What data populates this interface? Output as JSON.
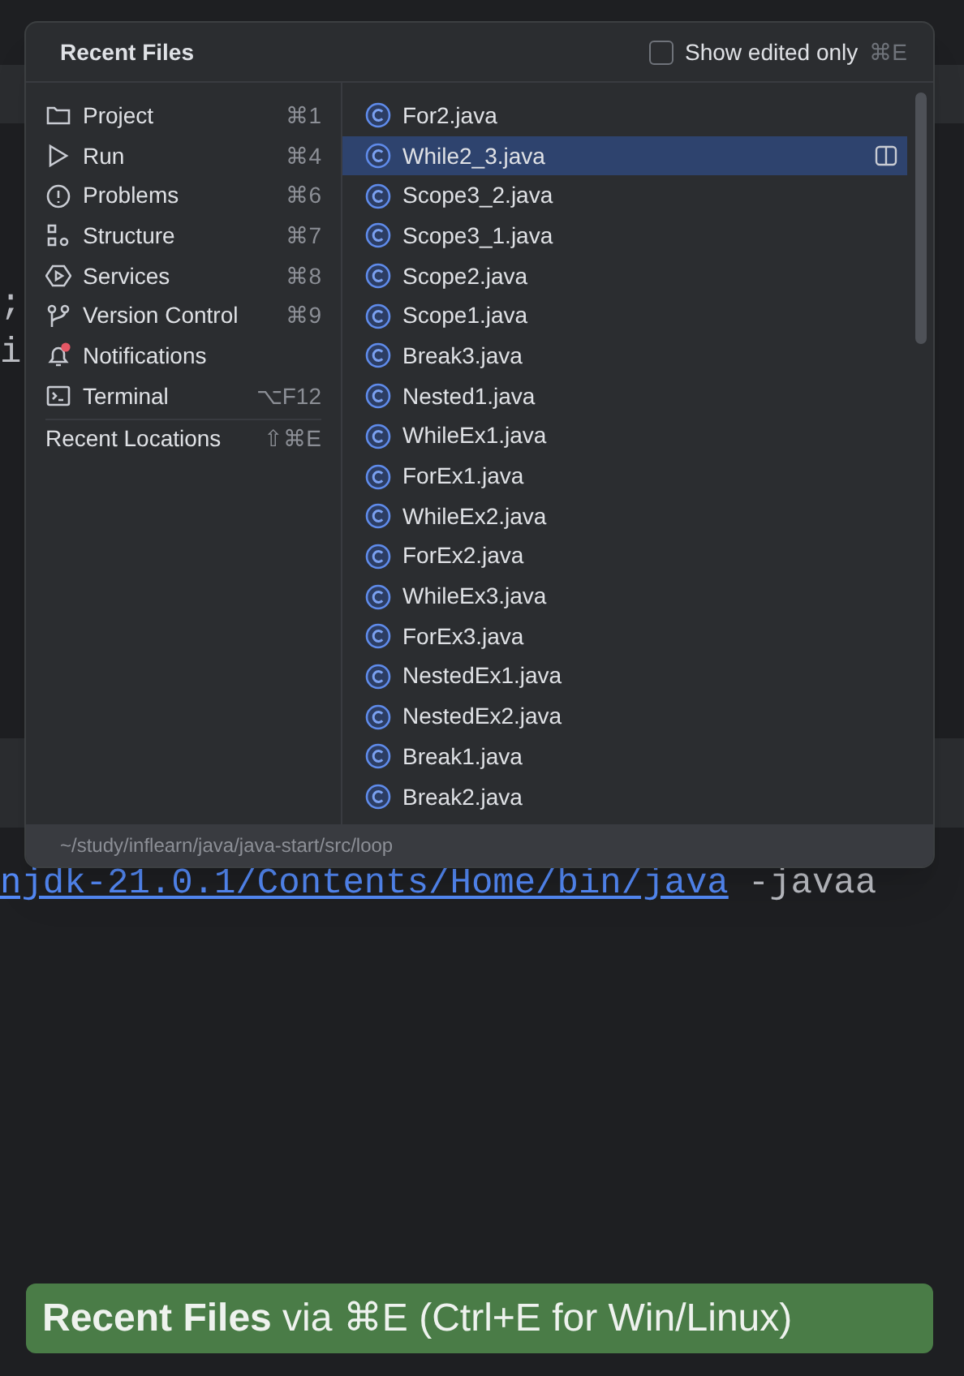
{
  "editor": {
    "code_fragments": [
      ";",
      "i"
    ],
    "console_line": {
      "path": "njdk-21.0.1/Contents/Home/bin/java",
      "args": "-javaa"
    }
  },
  "popup": {
    "title": "Recent Files",
    "show_edited_only": {
      "label": "Show edited only",
      "shortcut": "⌘E",
      "checked": false
    },
    "tool_windows": [
      {
        "label": "Project",
        "shortcut": "⌘1",
        "kind": "tool",
        "badge": false
      },
      {
        "label": "Run",
        "shortcut": "⌘4",
        "kind": "tool",
        "badge": false
      },
      {
        "label": "Problems",
        "shortcut": "⌘6",
        "kind": "tool",
        "badge": false
      },
      {
        "label": "Structure",
        "shortcut": "⌘7",
        "kind": "tool",
        "badge": false
      },
      {
        "label": "Services",
        "shortcut": "⌘8",
        "kind": "tool",
        "badge": false
      },
      {
        "label": "Version Control",
        "shortcut": "⌘9",
        "kind": "tool",
        "badge": false
      },
      {
        "label": "Notifications",
        "kind": "tool",
        "badge": true
      },
      {
        "label": "Terminal",
        "shortcut": "⌥F12",
        "kind": "tool",
        "badge": false
      },
      {
        "label": "Recent Locations",
        "shortcut": "⇧⌘E",
        "kind": "link"
      }
    ],
    "files": [
      {
        "name": "For2.java",
        "selected": false
      },
      {
        "name": "While2_3.java",
        "selected": true
      },
      {
        "name": "Scope3_2.java",
        "selected": false
      },
      {
        "name": "Scope3_1.java",
        "selected": false
      },
      {
        "name": "Scope2.java",
        "selected": false
      },
      {
        "name": "Scope1.java",
        "selected": false
      },
      {
        "name": "Break3.java",
        "selected": false
      },
      {
        "name": "Nested1.java",
        "selected": false
      },
      {
        "name": "WhileEx1.java",
        "selected": false
      },
      {
        "name": "ForEx1.java",
        "selected": false
      },
      {
        "name": "WhileEx2.java",
        "selected": false
      },
      {
        "name": "ForEx2.java",
        "selected": false
      },
      {
        "name": "WhileEx3.java",
        "selected": false
      },
      {
        "name": "ForEx3.java",
        "selected": false
      },
      {
        "name": "NestedEx1.java",
        "selected": false
      },
      {
        "name": "NestedEx2.java",
        "selected": false
      },
      {
        "name": "Break1.java",
        "selected": false
      },
      {
        "name": "Break2.java",
        "selected": false
      }
    ],
    "path": "~/study/inflearn/java/java-start/src/loop"
  },
  "banner": {
    "text": "**Recent Files** via ⌘E (Ctrl+E for Win/Linux)"
  }
}
